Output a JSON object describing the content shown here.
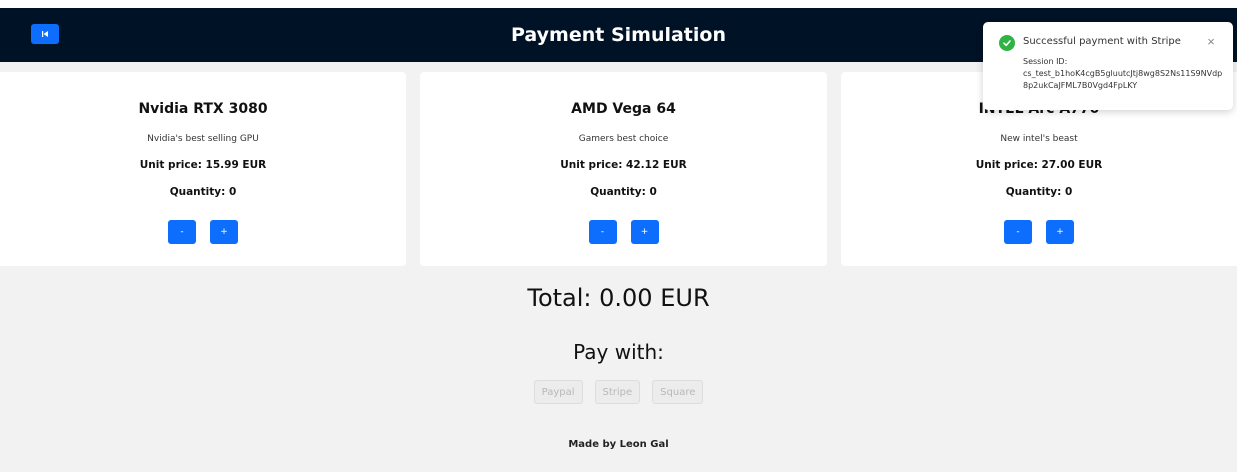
{
  "header": {
    "title": "Payment Simulation",
    "back_icon": "skip-back-icon"
  },
  "products": [
    {
      "name": "Nvidia RTX 3080",
      "description": "Nvidia's best selling GPU",
      "price": "Unit price: 15.99 EUR",
      "quantity": "Quantity: 0",
      "minus": "-",
      "plus": "+"
    },
    {
      "name": "AMD Vega 64",
      "description": "Gamers best choice",
      "price": "Unit price: 42.12 EUR",
      "quantity": "Quantity: 0",
      "minus": "-",
      "plus": "+"
    },
    {
      "name": "INTEL Arc A770",
      "description": "New intel's beast",
      "price": "Unit price: 27.00 EUR",
      "quantity": "Quantity: 0",
      "minus": "-",
      "plus": "+"
    }
  ],
  "total": "Total: 0.00 EUR",
  "pay_with": "Pay with:",
  "payment_buttons": [
    "Paypal",
    "Stripe",
    "Square"
  ],
  "footer": "Made by Leon Gal",
  "toast": {
    "title": "Successful payment with Stripe",
    "session_label": "Session ID:",
    "session_id": "cs_test_b1hoK4cgB5gluutcJtj8wg8S2Ns11S9NVdp8p2ukCaJFML7B0Vgd4FpLKY",
    "close": "×"
  },
  "colors": {
    "header_bg": "#001226",
    "primary": "#0d6efd",
    "page_bg": "#f2f2f2",
    "success": "#2fb344"
  }
}
